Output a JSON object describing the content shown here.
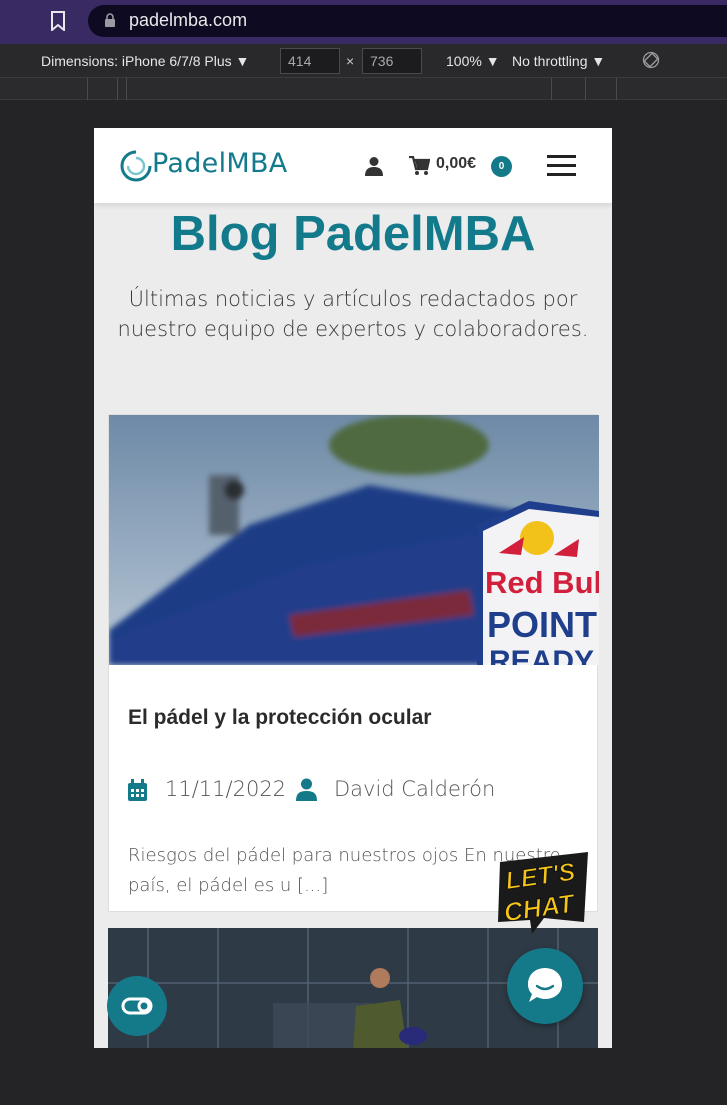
{
  "browser": {
    "url": "padelmba.com"
  },
  "devtools": {
    "dimensions_label": "Dimensions: iPhone 6/7/8 Plus ▼",
    "width_value": "414",
    "height_value": "736",
    "times": "×",
    "zoom_label": "100% ▼",
    "throttle_label": "No throttling ▼"
  },
  "header": {
    "logo_text": "PadelMBA",
    "cart_total": "0,00€",
    "cart_count": "0"
  },
  "page": {
    "title": "Blog PadelMBA",
    "subtitle": "Últimas noticias y artículos redactados por nuestro equipo de expertos y colaboradores."
  },
  "posts": [
    {
      "title": "El pádel y la protección ocular",
      "date": "11/11/2022",
      "author": "David Calderón",
      "excerpt": "Riesgos del pádel para nuestros ojos En nuestro país, el pádel es u [...]",
      "image_text": [
        "Red Bull",
        "POINT",
        "READY"
      ]
    }
  ],
  "chat": {
    "sticker_text": [
      "LET'S",
      "CHAT"
    ]
  },
  "colors": {
    "brand": "#137a8c",
    "browser_bar": "#3a2a63",
    "devtools_bar": "#29292c",
    "page_bg": "#ececec"
  },
  "icons": [
    "bookmark-icon",
    "lock-icon",
    "rotate-icon",
    "user-icon",
    "cart-icon",
    "menu-icon",
    "calendar-icon",
    "author-icon",
    "accessibility-icon",
    "chat-icon"
  ]
}
